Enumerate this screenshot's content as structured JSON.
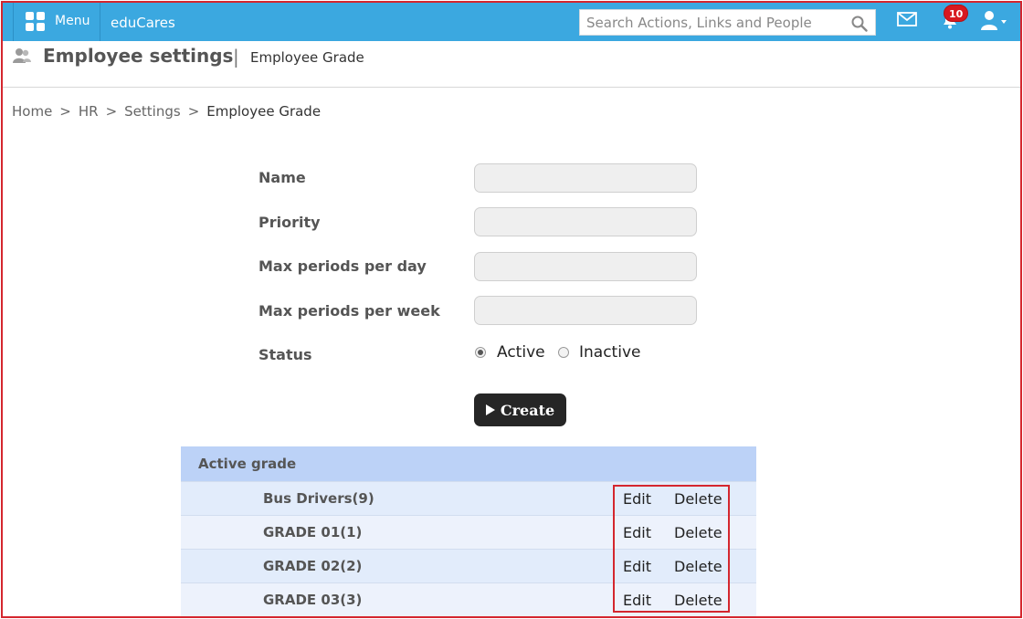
{
  "topbar": {
    "menu_label": "Menu",
    "brand": "eduCares",
    "search_placeholder": "Search Actions, Links and People",
    "notification_count": "10"
  },
  "header": {
    "title": "Employee settings",
    "separator": "|",
    "subtitle": "Employee Grade"
  },
  "breadcrumb": {
    "items": [
      "Home",
      "HR",
      "Settings",
      "Employee Grade"
    ],
    "separator": ">"
  },
  "form": {
    "name_label": "Name",
    "priority_label": "Priority",
    "max_day_label": "Max periods per day",
    "max_week_label": "Max periods per week",
    "status_label": "Status",
    "status_options": [
      "Active",
      "Inactive"
    ],
    "status_selected": "Active",
    "name_value": "",
    "priority_value": "",
    "max_day_value": "",
    "max_week_value": "",
    "create_label": "Create"
  },
  "grades": {
    "header": "Active grade",
    "edit_label": "Edit",
    "delete_label": "Delete",
    "rows": [
      {
        "name": "Bus Drivers(9)"
      },
      {
        "name": "GRADE 01(1)"
      },
      {
        "name": "GRADE 02(2)"
      },
      {
        "name": "GRADE 03(3)"
      }
    ]
  },
  "colors": {
    "topbar": "#3ba8e0",
    "highlight": "#d4262e",
    "table_header": "#bcd2f7",
    "badge": "#d7191f",
    "button": "#262626"
  },
  "icons": {
    "menu": "grid-icon",
    "search": "search-icon",
    "mail": "mail-icon",
    "notifications": "bell-icon",
    "user": "user-icon",
    "header": "users-icon"
  }
}
